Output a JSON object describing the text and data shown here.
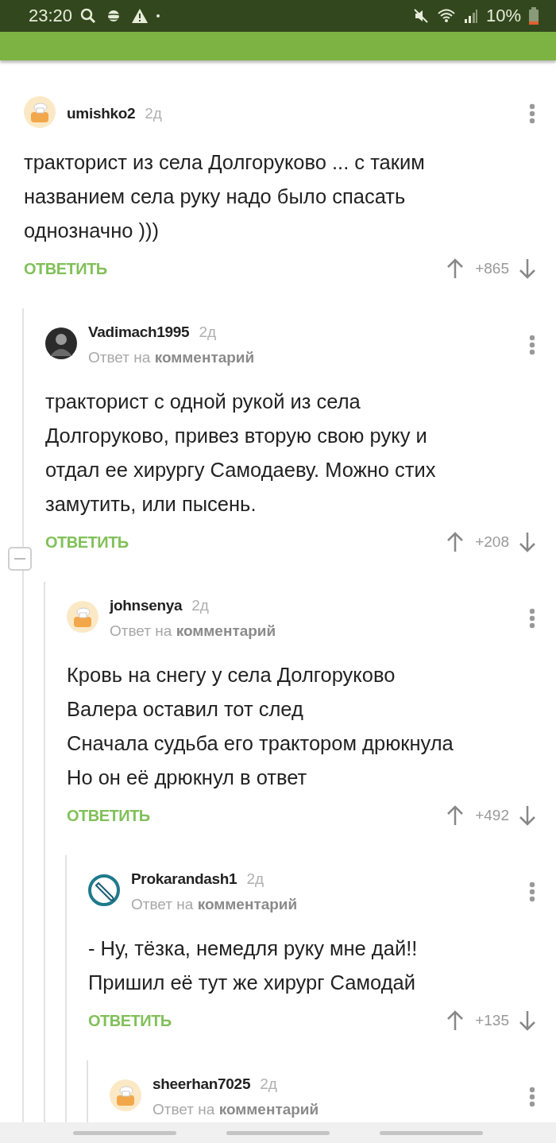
{
  "status_bar": {
    "time": "23:20",
    "battery": "10%"
  },
  "comments": [
    {
      "author": "umishko2",
      "age": "2д",
      "avatar": {
        "kind": "toast"
      },
      "text": "тракторист из села Долгоруково ... с таким\nназванием села руку надо было спасать\nоднозначно )))",
      "reply_label": "ОТВЕТИТЬ",
      "score": "+865",
      "children": [
        {
          "author": "Vadimach1995",
          "age": "2д",
          "avatar": {
            "kind": "photo"
          },
          "reply_to": "Ответ на **комментарий**",
          "text": "тракторист с одной рукой из села\nДолгоруково, привез вторую свою руку и\nотдал ее хирургу Самодаеву. Можно стих\nзамутить, или пысень.",
          "reply_label": "ОТВЕТИТЬ",
          "score": "+208",
          "expanded": true,
          "children": [
            {
              "author": "johnsenya",
              "age": "2д",
              "avatar": {
                "kind": "toast"
              },
              "reply_to": "Ответ на **комментарий**",
              "text": "Кровь на снегу у села Долгоруково\nВалера оставил тот след\nСначала судьба его трактором дрюкнула\nНо он её дрюкнул в ответ",
              "reply_label": "ОТВЕТИТЬ",
              "score": "+492",
              "children": [
                {
                  "author": "Prokarandash1",
                  "age": "2д",
                  "avatar": {
                    "kind": "pencil"
                  },
                  "reply_to": "Ответ на **комментарий**",
                  "text": "- Ну, тёзка, немедля руку мне дай!!\nПришил её тут же хирург Самодай",
                  "reply_label": "ОТВЕТИТЬ",
                  "score": "+135",
                  "children": [
                    {
                      "author": "sheerhan7025",
                      "age": "2д",
                      "avatar": {
                        "kind": "toast"
                      },
                      "reply_to": "Ответ на **комментарий**"
                    }
                  ]
                }
              ]
            }
          ]
        }
      ]
    }
  ]
}
